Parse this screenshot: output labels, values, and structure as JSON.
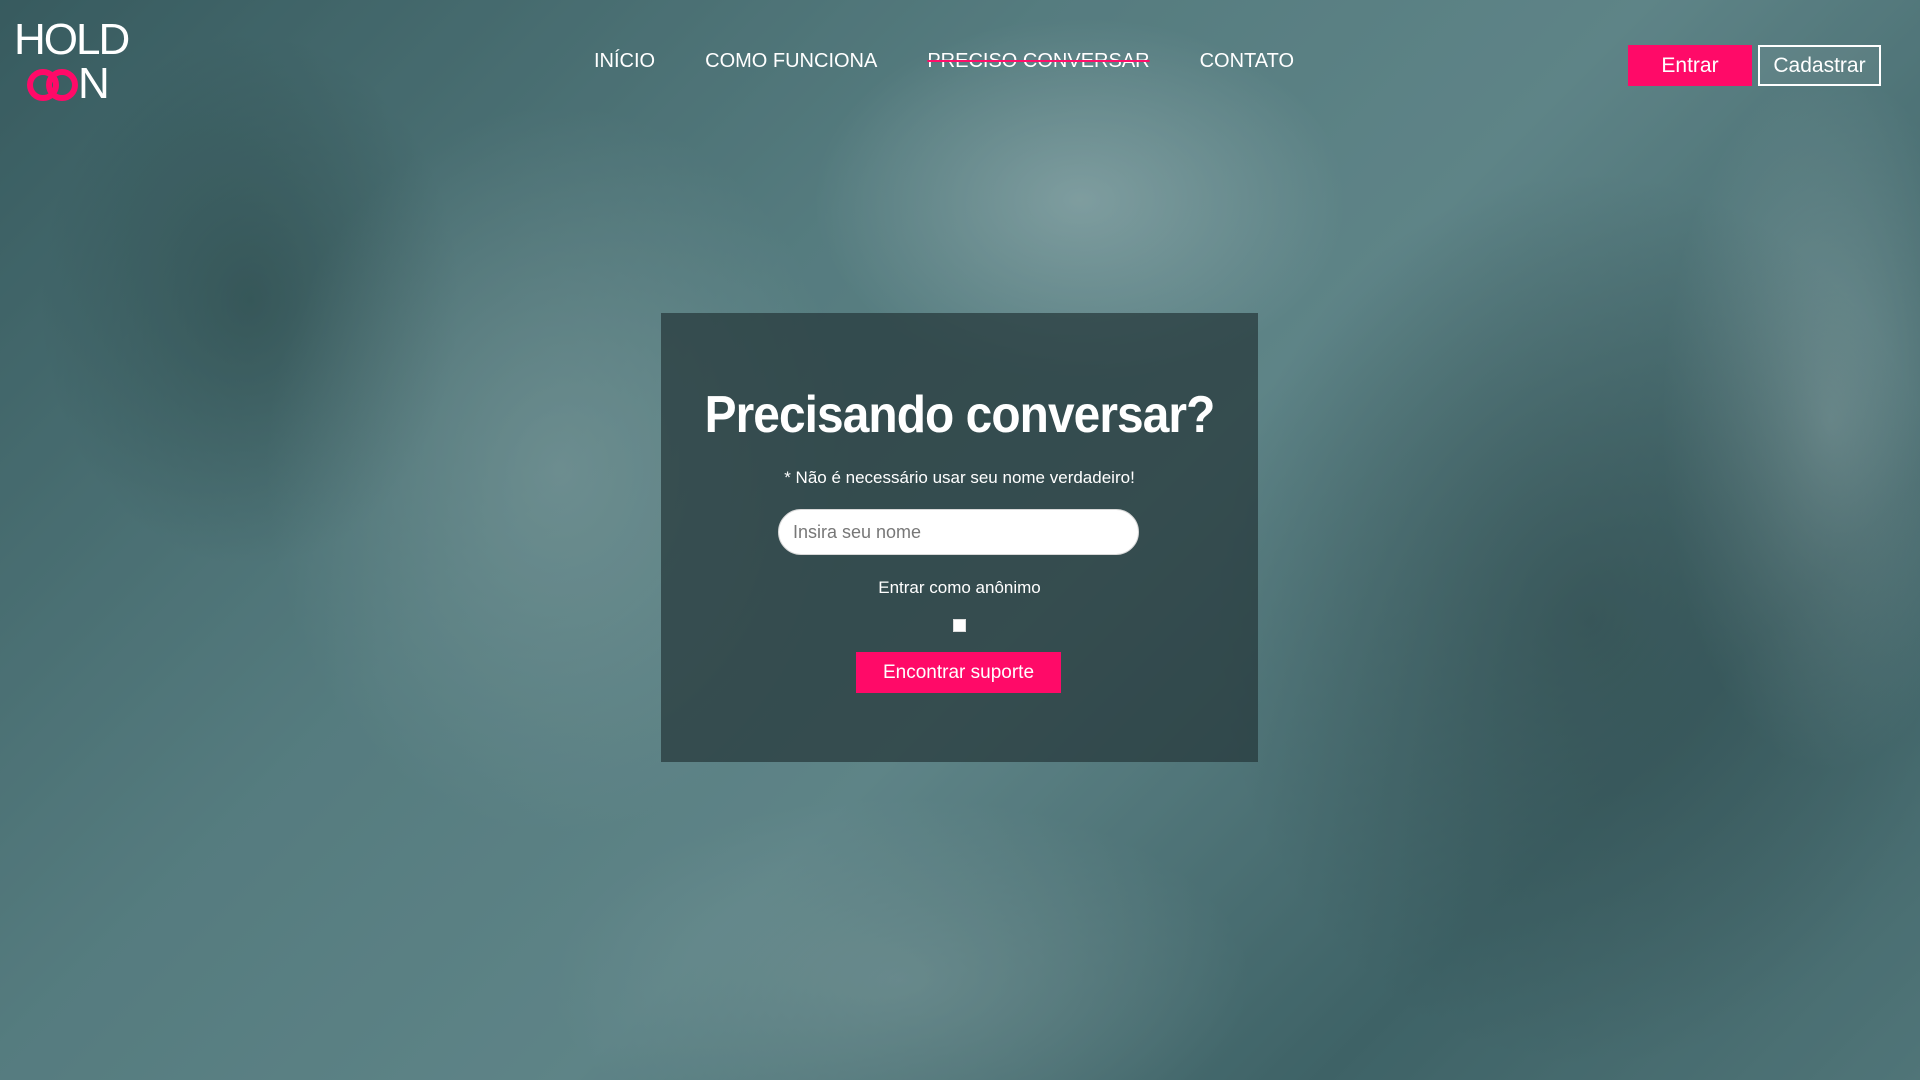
{
  "logo": {
    "top_text": "HOLD",
    "bottom_letter": "N",
    "ring_icon": "infinity-rings-icon"
  },
  "nav": {
    "items": [
      {
        "label": "INÍCIO",
        "active": false
      },
      {
        "label": "COMO FUNCIONA",
        "active": false
      },
      {
        "label": "PRECISO CONVERSAR",
        "active": true
      },
      {
        "label": "CONTATO",
        "active": false
      }
    ]
  },
  "auth": {
    "login_label": "Entrar",
    "signup_label": "Cadastrar"
  },
  "card": {
    "title": "Precisando conversar?",
    "note": "* Não é necessário usar seu nome verdadeiro!",
    "name_input": {
      "placeholder": "Insira seu nome",
      "value": ""
    },
    "anonymous_label": "Entrar como anônimo",
    "anonymous_checked": false,
    "submit_label": "Encontrar suporte"
  },
  "colors": {
    "accent": "#ff0a68",
    "overlay_card": "#26383a",
    "text": "#ffffff"
  }
}
